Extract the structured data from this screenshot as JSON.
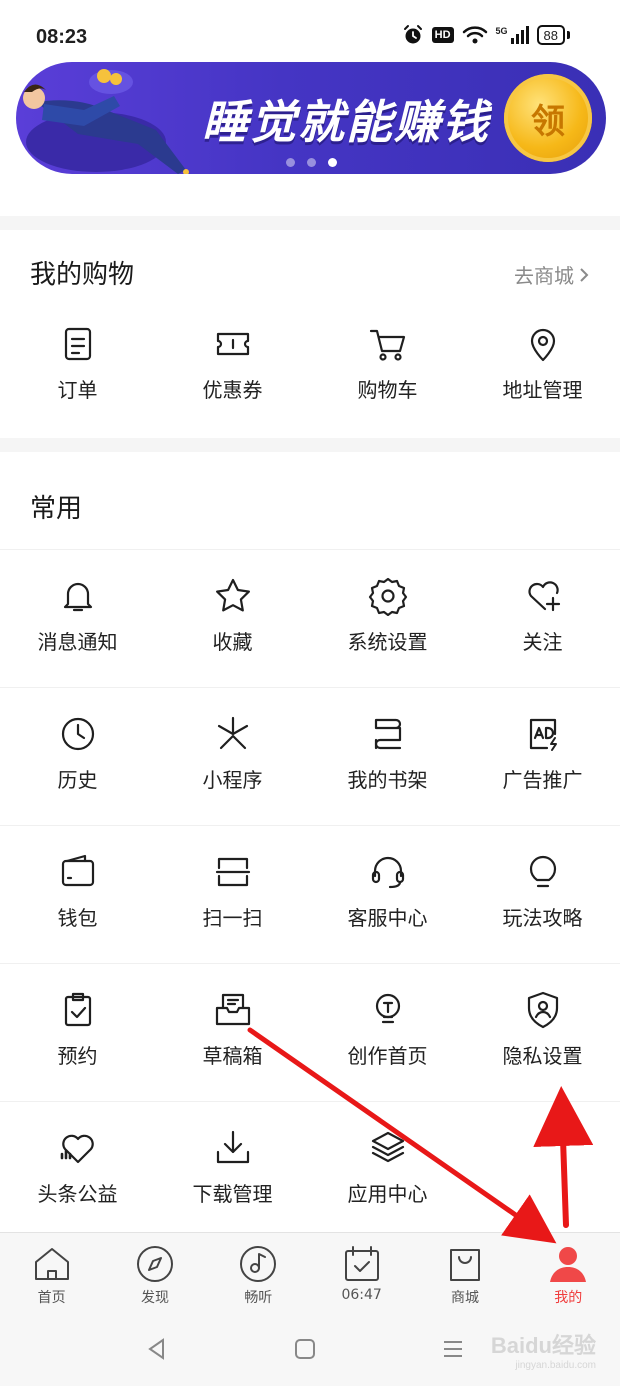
{
  "status": {
    "time": "08:23",
    "hd": "HD",
    "network": "5G",
    "battery": "88"
  },
  "banner": {
    "title": "睡觉就能赚钱",
    "coin_label": "领",
    "dots": 3,
    "active_dot": 2
  },
  "shopping": {
    "title": "我的购物",
    "goto_label": "去商城",
    "items": [
      {
        "label": "订单",
        "icon": "order-icon"
      },
      {
        "label": "优惠券",
        "icon": "coupon-icon"
      },
      {
        "label": "购物车",
        "icon": "cart-icon"
      },
      {
        "label": "地址管理",
        "icon": "location-pin-icon"
      }
    ]
  },
  "common": {
    "title": "常用",
    "items": [
      {
        "label": "消息通知",
        "icon": "bell-icon"
      },
      {
        "label": "收藏",
        "icon": "star-icon"
      },
      {
        "label": "系统设置",
        "icon": "gear-icon"
      },
      {
        "label": "关注",
        "icon": "heart-plus-icon"
      },
      {
        "label": "历史",
        "icon": "clock-icon"
      },
      {
        "label": "小程序",
        "icon": "mini-program-icon"
      },
      {
        "label": "我的书架",
        "icon": "bookshelf-icon"
      },
      {
        "label": "广告推广",
        "icon": "ad-icon"
      },
      {
        "label": "钱包",
        "icon": "wallet-icon"
      },
      {
        "label": "扫一扫",
        "icon": "scan-icon"
      },
      {
        "label": "客服中心",
        "icon": "headset-icon"
      },
      {
        "label": "玩法攻略",
        "icon": "lightbulb-icon"
      },
      {
        "label": "预约",
        "icon": "clipboard-check-icon"
      },
      {
        "label": "草稿箱",
        "icon": "draft-box-icon"
      },
      {
        "label": "创作首页",
        "icon": "creator-bulb-icon"
      },
      {
        "label": "隐私设置",
        "icon": "shield-user-icon"
      },
      {
        "label": "头条公益",
        "icon": "charity-heart-icon"
      },
      {
        "label": "下载管理",
        "icon": "download-icon"
      },
      {
        "label": "应用中心",
        "icon": "layers-icon"
      }
    ]
  },
  "tabbar": {
    "tabs": [
      {
        "label": "首页",
        "icon": "home-icon"
      },
      {
        "label": "发现",
        "icon": "compass-icon"
      },
      {
        "label": "畅听",
        "icon": "music-note-icon"
      },
      {
        "label": "06:47",
        "icon": "calendar-check-icon"
      },
      {
        "label": "商城",
        "icon": "shopping-bag-icon"
      },
      {
        "label": "我的",
        "icon": "person-icon"
      }
    ],
    "active_index": 5,
    "active_color": "#f03c3c"
  },
  "watermark": {
    "text": "Baidu经验",
    "sub": "jingyan.baidu.com"
  }
}
